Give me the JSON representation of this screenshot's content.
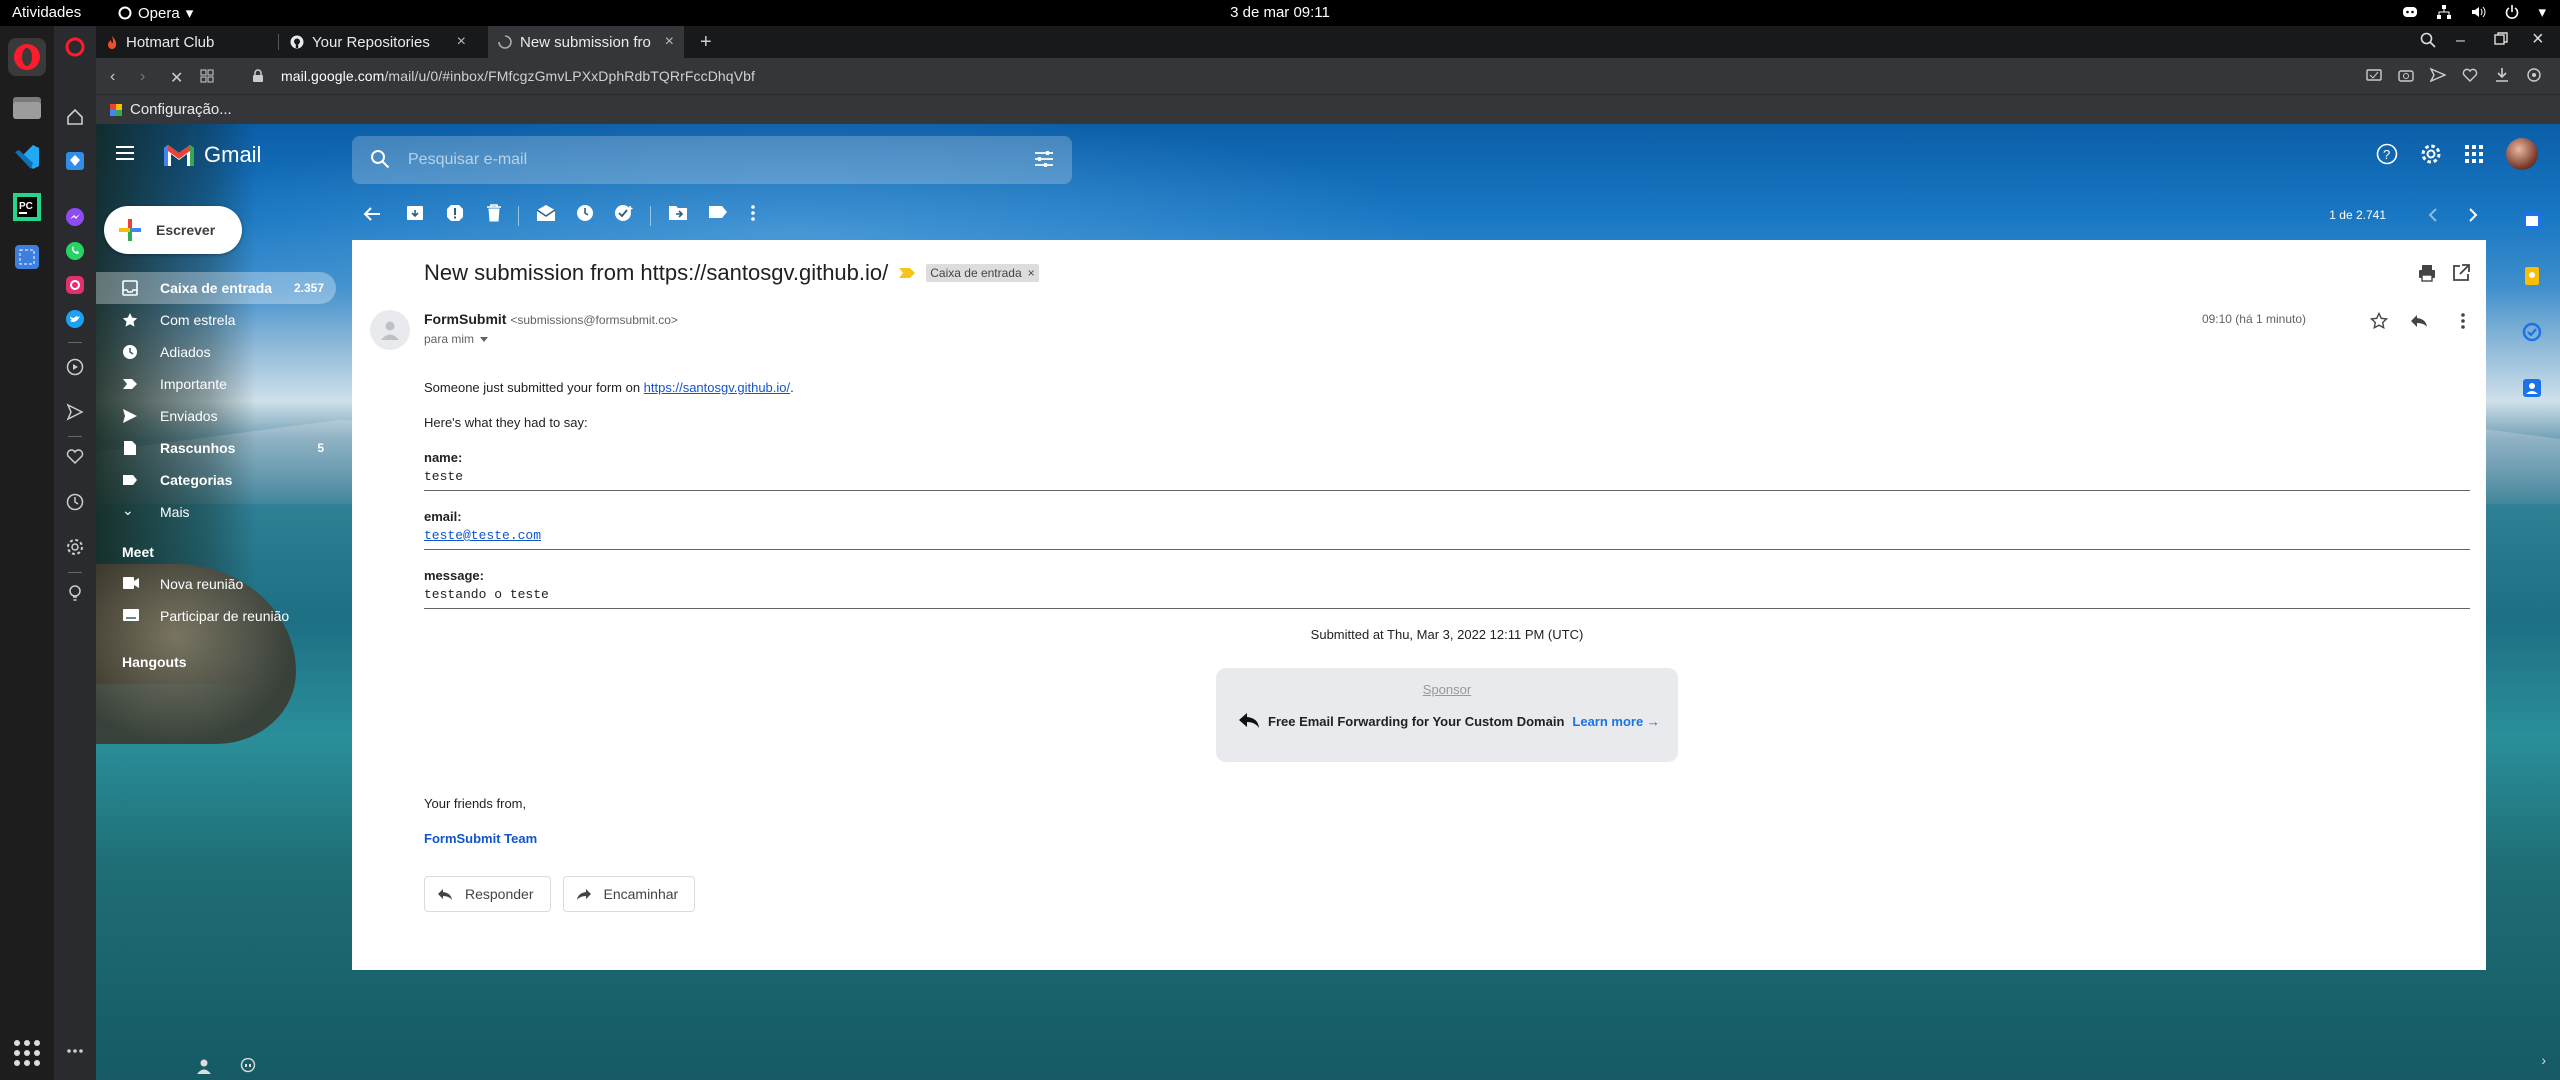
{
  "topbar": {
    "activities": "Atividades",
    "app": "Opera",
    "clock": "3 de mar  09:11"
  },
  "tabs": [
    {
      "label": "Hotmart Club"
    },
    {
      "label": "Your Repositories"
    },
    {
      "label": "New submission fro"
    }
  ],
  "address": {
    "host": "mail.google.com",
    "path": "/mail/u/0/#inbox/FMfcgzGmvLPXxDphRdbTQRrFccDhqVbf"
  },
  "bookmarks": {
    "item": "Configuração..."
  },
  "gmail": {
    "brand": "Gmail",
    "search_placeholder": "Pesquisar e-mail",
    "compose": "Escrever",
    "nav": [
      {
        "label": "Caixa de entrada",
        "count": "2.357"
      },
      {
        "label": "Com estrela"
      },
      {
        "label": "Adiados"
      },
      {
        "label": "Importante"
      },
      {
        "label": "Enviados"
      },
      {
        "label": "Rascunhos",
        "count": "5"
      },
      {
        "label": "Categorias"
      },
      {
        "label": "Mais"
      }
    ],
    "meet": {
      "title": "Meet",
      "new_meeting": "Nova reunião",
      "join": "Participar de reunião"
    },
    "hangouts": "Hangouts",
    "pager": "1 de 2.741"
  },
  "message": {
    "subject": "New submission from https://santosgv.github.io/",
    "label": "Caixa de entrada",
    "sender_name": "FormSubmit",
    "sender_email": "<submissions@formsubmit.co>",
    "to": "para mim",
    "time": "09:10 (há 1 minuto)",
    "intro_text": "Someone just submitted your form on ",
    "intro_link": "https://santosgv.github.io/",
    "intro_end": ".",
    "say": "Here's what they had to say:",
    "fields": [
      {
        "key": "name:",
        "value": "teste"
      },
      {
        "key": "email:",
        "value": "teste@teste.com"
      },
      {
        "key": "message:",
        "value": "testando o teste"
      }
    ],
    "submitted": "Submitted at Thu, Mar 3, 2022 12:11 PM (UTC)",
    "sponsor_head": "Sponsor",
    "sponsor_text": "Free Email Forwarding for Your Custom Domain",
    "sponsor_link": "Learn more →",
    "friends": "Your friends from,",
    "team": "FormSubmit Team",
    "reply": "Responder",
    "forward": "Encaminhar"
  }
}
